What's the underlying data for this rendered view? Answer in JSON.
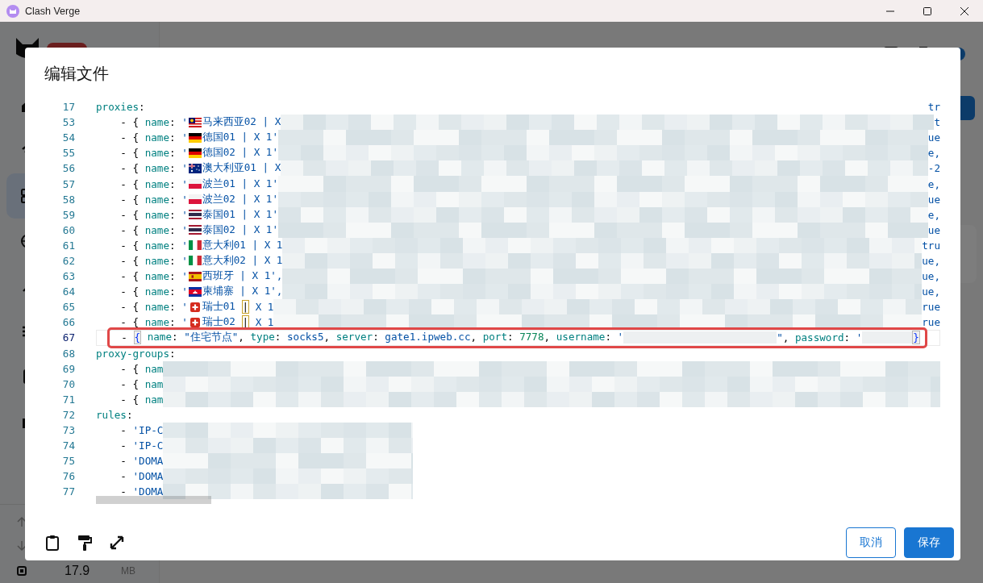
{
  "window": {
    "title": "Clash Verge"
  },
  "app": {
    "nav": [
      {
        "kind": "home",
        "selected": false
      },
      {
        "kind": "signal",
        "selected": false
      },
      {
        "kind": "grid",
        "selected": true
      },
      {
        "kind": "globe",
        "selected": false
      },
      {
        "kind": "link",
        "selected": false
      },
      {
        "kind": "list",
        "selected": false
      },
      {
        "kind": "device",
        "selected": false
      },
      {
        "kind": "puzzle",
        "selected": false
      }
    ],
    "memory": {
      "value": "17.9",
      "unit": "MB"
    }
  },
  "dialog": {
    "title": "编辑文件",
    "lines": [
      {
        "number": "17",
        "current": false,
        "marked": false,
        "segments": [
          {
            "kind": "key",
            "text": "proxies"
          },
          {
            "kind": "plain",
            "text": ":"
          },
          {
            "kind": "tail",
            "text": "tr"
          }
        ]
      },
      {
        "number": "53",
        "current": false,
        "marked": false,
        "segments": [
          {
            "kind": "plain",
            "text": "    - { "
          },
          {
            "kind": "key",
            "text": "name"
          },
          {
            "kind": "plain",
            "text": ": "
          },
          {
            "kind": "string",
            "text": "'"
          },
          {
            "kind": "flag_my"
          },
          {
            "kind": "string",
            "text": "马来西亚02 | X"
          },
          {
            "kind": "blur"
          },
          {
            "kind": "tail",
            "text": "t"
          }
        ]
      },
      {
        "number": "54",
        "current": false,
        "marked": false,
        "segments": [
          {
            "kind": "plain",
            "text": "    - { "
          },
          {
            "kind": "key",
            "text": "name"
          },
          {
            "kind": "plain",
            "text": ": "
          },
          {
            "kind": "string",
            "text": "'"
          },
          {
            "kind": "flag_de"
          },
          {
            "kind": "string",
            "text": "德国01 | X 1'"
          },
          {
            "kind": "blur"
          },
          {
            "kind": "tail",
            "text": "ue"
          }
        ]
      },
      {
        "number": "55",
        "current": false,
        "marked": false,
        "segments": [
          {
            "kind": "plain",
            "text": "    - { "
          },
          {
            "kind": "key",
            "text": "name"
          },
          {
            "kind": "plain",
            "text": ": "
          },
          {
            "kind": "string",
            "text": "'"
          },
          {
            "kind": "flag_de"
          },
          {
            "kind": "string",
            "text": "德国02 | X 1'"
          },
          {
            "kind": "blur"
          },
          {
            "kind": "tail",
            "text": "e,"
          }
        ]
      },
      {
        "number": "56",
        "current": false,
        "marked": false,
        "segments": [
          {
            "kind": "plain",
            "text": "    - { "
          },
          {
            "kind": "key",
            "text": "name"
          },
          {
            "kind": "plain",
            "text": ": "
          },
          {
            "kind": "string",
            "text": "'"
          },
          {
            "kind": "flag_au"
          },
          {
            "kind": "string",
            "text": "澳大利亚01 | X"
          },
          {
            "kind": "blur"
          },
          {
            "kind": "tail",
            "text": "-2"
          }
        ]
      },
      {
        "number": "57",
        "current": false,
        "marked": false,
        "segments": [
          {
            "kind": "plain",
            "text": "    - { "
          },
          {
            "kind": "key",
            "text": "name"
          },
          {
            "kind": "plain",
            "text": ": "
          },
          {
            "kind": "string",
            "text": "'"
          },
          {
            "kind": "flag_pl"
          },
          {
            "kind": "string",
            "text": "波兰01 | X 1'"
          },
          {
            "kind": "blur"
          },
          {
            "kind": "tail",
            "text": "e,"
          }
        ]
      },
      {
        "number": "58",
        "current": false,
        "marked": false,
        "segments": [
          {
            "kind": "plain",
            "text": "    - { "
          },
          {
            "kind": "key",
            "text": "name"
          },
          {
            "kind": "plain",
            "text": ": "
          },
          {
            "kind": "string",
            "text": "'"
          },
          {
            "kind": "flag_pl"
          },
          {
            "kind": "string",
            "text": "波兰02 | X 1'"
          },
          {
            "kind": "blur"
          },
          {
            "kind": "tail",
            "text": "ue"
          }
        ]
      },
      {
        "number": "59",
        "current": false,
        "marked": false,
        "segments": [
          {
            "kind": "plain",
            "text": "    - { "
          },
          {
            "kind": "key",
            "text": "name"
          },
          {
            "kind": "plain",
            "text": ": "
          },
          {
            "kind": "string",
            "text": "'"
          },
          {
            "kind": "flag_th"
          },
          {
            "kind": "string",
            "text": "泰国01 | X 1'"
          },
          {
            "kind": "blur"
          },
          {
            "kind": "tail",
            "text": "e,"
          }
        ]
      },
      {
        "number": "60",
        "current": false,
        "marked": false,
        "segments": [
          {
            "kind": "plain",
            "text": "    - { "
          },
          {
            "kind": "key",
            "text": "name"
          },
          {
            "kind": "plain",
            "text": ": "
          },
          {
            "kind": "string",
            "text": "'"
          },
          {
            "kind": "flag_th"
          },
          {
            "kind": "string",
            "text": "泰国02 | X 1'"
          },
          {
            "kind": "blur"
          },
          {
            "kind": "tail",
            "text": "ue"
          }
        ]
      },
      {
        "number": "61",
        "current": false,
        "marked": false,
        "segments": [
          {
            "kind": "plain",
            "text": "    - { "
          },
          {
            "kind": "key",
            "text": "name"
          },
          {
            "kind": "plain",
            "text": ": "
          },
          {
            "kind": "string",
            "text": "'"
          },
          {
            "kind": "flag_it"
          },
          {
            "kind": "string",
            "text": "意大利01 | X 1"
          },
          {
            "kind": "blur"
          },
          {
            "kind": "tail",
            "text": "tru"
          }
        ]
      },
      {
        "number": "62",
        "current": false,
        "marked": false,
        "segments": [
          {
            "kind": "plain",
            "text": "    - { "
          },
          {
            "kind": "key",
            "text": "name"
          },
          {
            "kind": "plain",
            "text": ": "
          },
          {
            "kind": "string",
            "text": "'"
          },
          {
            "kind": "flag_it"
          },
          {
            "kind": "string",
            "text": "意大利02 | X 1"
          },
          {
            "kind": "blur"
          },
          {
            "kind": "tail",
            "text": "ue,"
          }
        ]
      },
      {
        "number": "63",
        "current": false,
        "marked": false,
        "segments": [
          {
            "kind": "plain",
            "text": "    - { "
          },
          {
            "kind": "key",
            "text": "name"
          },
          {
            "kind": "plain",
            "text": ": "
          },
          {
            "kind": "string",
            "text": "'"
          },
          {
            "kind": "flag_es"
          },
          {
            "kind": "string",
            "text": "西班牙 | X 1',"
          },
          {
            "kind": "blur"
          },
          {
            "kind": "tail",
            "text": "ue,"
          }
        ]
      },
      {
        "number": "64",
        "current": false,
        "marked": false,
        "segments": [
          {
            "kind": "plain",
            "text": "    - { "
          },
          {
            "kind": "key",
            "text": "name"
          },
          {
            "kind": "plain",
            "text": ": "
          },
          {
            "kind": "string",
            "text": "'"
          },
          {
            "kind": "flag_kh"
          },
          {
            "kind": "string",
            "text": "柬埔寨 | X 1',"
          },
          {
            "kind": "blur"
          },
          {
            "kind": "tail",
            "text": "ue,"
          }
        ]
      },
      {
        "number": "65",
        "current": false,
        "marked": false,
        "segments": [
          {
            "kind": "plain",
            "text": "    - { "
          },
          {
            "kind": "key",
            "text": "name"
          },
          {
            "kind": "plain",
            "text": ": "
          },
          {
            "kind": "string",
            "text": "'"
          },
          {
            "kind": "flag_ch"
          },
          {
            "kind": "string",
            "text": "瑞士01 "
          },
          {
            "kind": "match",
            "text": "|"
          },
          {
            "kind": "string",
            "text": " X 1"
          },
          {
            "kind": "blur"
          },
          {
            "kind": "tail",
            "text": "rue"
          }
        ]
      },
      {
        "number": "66",
        "current": false,
        "marked": false,
        "segments": [
          {
            "kind": "plain",
            "text": "    - { "
          },
          {
            "kind": "key",
            "text": "name"
          },
          {
            "kind": "plain",
            "text": ": "
          },
          {
            "kind": "string",
            "text": "'"
          },
          {
            "kind": "flag_ch"
          },
          {
            "kind": "string",
            "text": "瑞士02 "
          },
          {
            "kind": "match",
            "text": "|"
          },
          {
            "kind": "string",
            "text": " X 1"
          },
          {
            "kind": "blur"
          },
          {
            "kind": "tail",
            "text": "rue"
          }
        ]
      },
      {
        "number": "67",
        "current": true,
        "marked": true,
        "segments": [
          {
            "kind": "plain",
            "text": "    - "
          },
          {
            "kind": "bracket",
            "text": "{"
          },
          {
            "kind": "key",
            "text": "name"
          },
          {
            "kind": "plain",
            "text": ": "
          },
          {
            "kind": "string",
            "text": "\"住宅节点\""
          },
          {
            "kind": "plain",
            "text": ", "
          },
          {
            "kind": "key",
            "text": "type"
          },
          {
            "kind": "plain",
            "text": ": "
          },
          {
            "kind": "value",
            "text": "socks5"
          },
          {
            "kind": "plain",
            "text": ", "
          },
          {
            "kind": "key",
            "text": "server"
          },
          {
            "kind": "plain",
            "text": ": "
          },
          {
            "kind": "value",
            "text": "gate1.ipweb.cc"
          },
          {
            "kind": "plain",
            "text": ", "
          },
          {
            "kind": "key",
            "text": "port"
          },
          {
            "kind": "plain",
            "text": ": "
          },
          {
            "kind": "number",
            "text": "7778"
          },
          {
            "kind": "plain",
            "text": ", "
          },
          {
            "kind": "key",
            "text": "username"
          },
          {
            "kind": "plain",
            "text": ": "
          },
          {
            "kind": "string",
            "text": "'"
          },
          {
            "kind": "redacted_long"
          },
          {
            "kind": "string",
            "text": "\""
          },
          {
            "kind": "plain",
            "text": ", "
          },
          {
            "kind": "key",
            "text": "password"
          },
          {
            "kind": "plain",
            "text": ": "
          },
          {
            "kind": "string",
            "text": "'"
          },
          {
            "kind": "redacted_short"
          },
          {
            "kind": "bracket",
            "text": "}"
          }
        ]
      },
      {
        "number": "68",
        "current": false,
        "marked": false,
        "segments": [
          {
            "kind": "key",
            "text": "proxy-groups"
          },
          {
            "kind": "plain",
            "text": ":"
          }
        ]
      },
      {
        "number": "69",
        "current": false,
        "marked": false,
        "segments": [
          {
            "kind": "plain",
            "text": "    - { "
          },
          {
            "kind": "key",
            "text": "nam"
          },
          {
            "kind": "blur"
          }
        ]
      },
      {
        "number": "70",
        "current": false,
        "marked": false,
        "segments": [
          {
            "kind": "plain",
            "text": "    - { "
          },
          {
            "kind": "key",
            "text": "nam"
          },
          {
            "kind": "blur"
          }
        ]
      },
      {
        "number": "71",
        "current": false,
        "marked": false,
        "segments": [
          {
            "kind": "plain",
            "text": "    - { "
          },
          {
            "kind": "key",
            "text": "nam"
          },
          {
            "kind": "blur"
          }
        ]
      },
      {
        "number": "72",
        "current": false,
        "marked": false,
        "segments": [
          {
            "kind": "key",
            "text": "rules"
          },
          {
            "kind": "plain",
            "text": ":"
          }
        ]
      },
      {
        "number": "73",
        "current": false,
        "marked": false,
        "segments": [
          {
            "kind": "plain",
            "text": "    - "
          },
          {
            "kind": "string",
            "text": "'IP-C"
          },
          {
            "kind": "blur_partial"
          }
        ]
      },
      {
        "number": "74",
        "current": false,
        "marked": false,
        "segments": [
          {
            "kind": "plain",
            "text": "    - "
          },
          {
            "kind": "string",
            "text": "'IP-C"
          },
          {
            "kind": "blur_partial"
          }
        ]
      },
      {
        "number": "75",
        "current": false,
        "marked": false,
        "segments": [
          {
            "kind": "plain",
            "text": "    - "
          },
          {
            "kind": "string",
            "text": "'DOMA"
          },
          {
            "kind": "blur_partial"
          }
        ]
      },
      {
        "number": "76",
        "current": false,
        "marked": false,
        "segments": [
          {
            "kind": "plain",
            "text": "    - "
          },
          {
            "kind": "string",
            "text": "'DOMA"
          },
          {
            "kind": "blur_partial"
          }
        ]
      },
      {
        "number": "77",
        "current": false,
        "marked": false,
        "segments": [
          {
            "kind": "plain",
            "text": "    - "
          },
          {
            "kind": "string",
            "text": "'DOMA"
          },
          {
            "kind": "blur_partial"
          }
        ]
      }
    ],
    "buttons": [
      {
        "label": "取消",
        "kind": "outlined"
      },
      {
        "label": "保存",
        "kind": "filled"
      }
    ]
  }
}
